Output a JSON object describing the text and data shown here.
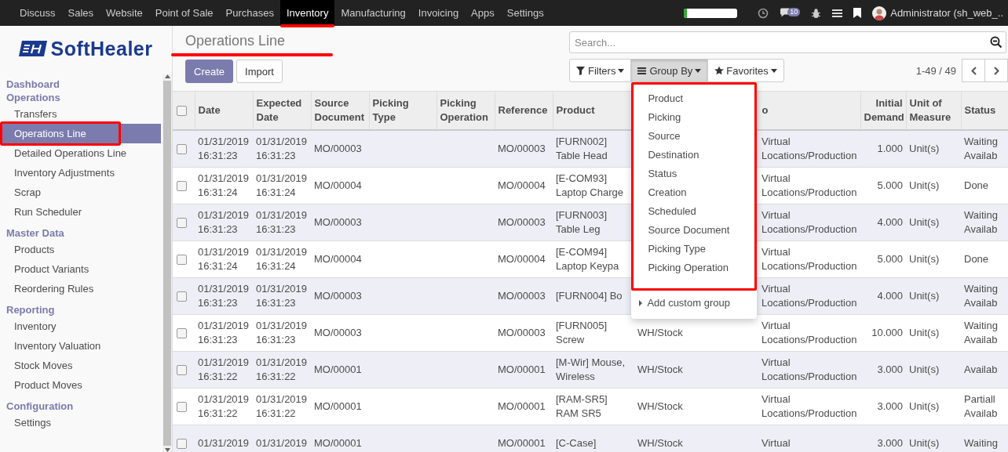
{
  "top_menu": {
    "apps": [
      {
        "label": "Discuss",
        "selected": false,
        "highlighted": false
      },
      {
        "label": "Sales",
        "selected": false,
        "highlighted": false
      },
      {
        "label": "Website",
        "selected": false,
        "highlighted": false
      },
      {
        "label": "Point of Sale",
        "selected": false,
        "highlighted": false
      },
      {
        "label": "Purchases",
        "selected": false,
        "highlighted": false
      },
      {
        "label": "Inventory",
        "selected": true,
        "highlighted": true
      },
      {
        "label": "Manufacturing",
        "selected": false,
        "highlighted": false
      },
      {
        "label": "Invoicing",
        "selected": false,
        "highlighted": false
      },
      {
        "label": "Apps",
        "selected": false,
        "highlighted": false
      },
      {
        "label": "Settings",
        "selected": false,
        "highlighted": false
      }
    ],
    "progress": {
      "level": 0.06
    },
    "messages_badge": "10",
    "user": "Administrator (sh_web_.."
  },
  "sidebar": {
    "logo": "SoftHealer",
    "sections": [
      {
        "title": "Dashboard"
      },
      {
        "title": "Operations",
        "items": [
          {
            "label": "Transfers",
            "selected": false,
            "highlighted": false
          },
          {
            "label": "Operations Line",
            "selected": true,
            "highlighted": true
          },
          {
            "label": "Detailed Operations Line",
            "selected": false,
            "highlighted": false
          },
          {
            "label": "Inventory Adjustments",
            "selected": false,
            "highlighted": false
          },
          {
            "label": "Scrap",
            "selected": false,
            "highlighted": false
          },
          {
            "label": "Run Scheduler",
            "selected": false,
            "highlighted": false
          }
        ]
      },
      {
        "title": "Master Data",
        "items": [
          {
            "label": "Products",
            "selected": false,
            "highlighted": false
          },
          {
            "label": "Product Variants",
            "selected": false,
            "highlighted": false
          },
          {
            "label": "Reordering Rules",
            "selected": false,
            "highlighted": false
          }
        ]
      },
      {
        "title": "Reporting",
        "items": [
          {
            "label": "Inventory",
            "selected": false,
            "highlighted": false
          },
          {
            "label": "Inventory Valuation",
            "selected": false,
            "highlighted": false
          },
          {
            "label": "Stock Moves",
            "selected": false,
            "highlighted": false
          },
          {
            "label": "Product Moves",
            "selected": false,
            "highlighted": false
          }
        ]
      },
      {
        "title": "Configuration",
        "items": [
          {
            "label": "Settings",
            "selected": false,
            "highlighted": false
          }
        ]
      }
    ]
  },
  "breadcrumb": {
    "title": "Operations Line",
    "highlighted": true
  },
  "buttons": [
    {
      "label": "Create",
      "kind": "primary"
    },
    {
      "label": "Import",
      "kind": "secondary"
    }
  ],
  "search": {
    "placeholder": "Search..."
  },
  "search_options": [
    {
      "label": "Filters",
      "kind": "filter",
      "open": false
    },
    {
      "label": "Group By",
      "kind": "bars",
      "open": true
    },
    {
      "label": "Favorites",
      "kind": "star",
      "open": false
    }
  ],
  "group_by_menu": {
    "highlighted": true,
    "items": [
      "Product",
      "Picking",
      "Source",
      "Destination",
      "Status",
      "Creation",
      "Scheduled",
      "Source Document",
      "Picking Type",
      "Picking Operation"
    ],
    "custom": "Add custom group"
  },
  "pager": "1-49 / 49",
  "table": {
    "all_checked": false,
    "columns": [
      {
        "label": "Date"
      },
      {
        "label": "Expected Date"
      },
      {
        "label": "Source Document"
      },
      {
        "label": "Picking Type"
      },
      {
        "label": "Picking Operation"
      },
      {
        "label": "Reference"
      },
      {
        "label": "Product"
      },
      {},
      {
        "label": "o"
      },
      {
        "label": "Initial Demand"
      },
      {
        "label": "Unit of Measure"
      },
      {
        "label": "Status"
      }
    ],
    "rows": [
      {
        "checked": false,
        "cells": [
          "01/31/2019 16:31:23",
          "01/31/2019 16:31:23",
          "MO/00003",
          null,
          null,
          "MO/00003",
          "[FURN002] Table Head",
          null,
          "Virtual Locations/Production",
          "1.000",
          "Unit(s)",
          "Waiting Availab"
        ]
      },
      {
        "checked": false,
        "cells": [
          "01/31/2019 16:31:24",
          "01/31/2019 16:31:24",
          "MO/00004",
          null,
          null,
          "MO/00004",
          "[E-COM93] Laptop Charge",
          null,
          "Virtual Locations/Production",
          "5.000",
          "Unit(s)",
          "Done"
        ]
      },
      {
        "checked": false,
        "cells": [
          "01/31/2019 16:31:23",
          "01/31/2019 16:31:23",
          "MO/00003",
          null,
          null,
          "MO/00003",
          "[FURN003] Table Leg",
          null,
          "Virtual Locations/Production",
          "4.000",
          "Unit(s)",
          "Waiting Availab"
        ]
      },
      {
        "checked": false,
        "cells": [
          "01/31/2019 16:31:24",
          "01/31/2019 16:31:24",
          "MO/00004",
          null,
          null,
          "MO/00004",
          "[E-COM94] Laptop Keypa",
          null,
          "Virtual Locations/Production",
          "5.000",
          "Unit(s)",
          "Done"
        ]
      },
      {
        "checked": false,
        "cells": [
          "01/31/2019 16:31:23",
          "01/31/2019 16:31:23",
          "MO/00003",
          null,
          null,
          "MO/00003",
          "[FURN004] Bo",
          null,
          "Virtual Locations/Production",
          "4.000",
          "Unit(s)",
          "Waiting Availab"
        ]
      },
      {
        "checked": false,
        "cells": [
          "01/31/2019 16:31:23",
          "01/31/2019 16:31:23",
          "MO/00003",
          null,
          null,
          "MO/00003",
          "[FURN005] Screw",
          "WH/Stock",
          "Virtual Locations/Production",
          "10.000",
          "Unit(s)",
          "Waiting Availab"
        ]
      },
      {
        "checked": false,
        "cells": [
          "01/31/2019 16:31:22",
          "01/31/2019 16:31:22",
          "MO/00001",
          null,
          null,
          "MO/00001",
          "[M-Wir] Mouse, Wireless",
          "WH/Stock",
          "Virtual Locations/Production",
          "3.000",
          "Unit(s)",
          "Availab"
        ]
      },
      {
        "checked": false,
        "cells": [
          "01/31/2019 16:31:22",
          "01/31/2019 16:31:22",
          "MO/00001",
          null,
          null,
          "MO/00001",
          "[RAM-SR5] RAM SR5",
          "WH/Stock",
          "Virtual Locations/Production",
          "3.000",
          "Unit(s)",
          "Partiall Availab"
        ]
      },
      {
        "checked": false,
        "cells": [
          "01/31/2019",
          "01/31/2019",
          "MO/00001",
          null,
          null,
          "MO/00001",
          "[C-Case]",
          "WH/Stock",
          "Virtual",
          "3.000",
          "Unit(s)",
          "Waiting"
        ]
      }
    ]
  }
}
